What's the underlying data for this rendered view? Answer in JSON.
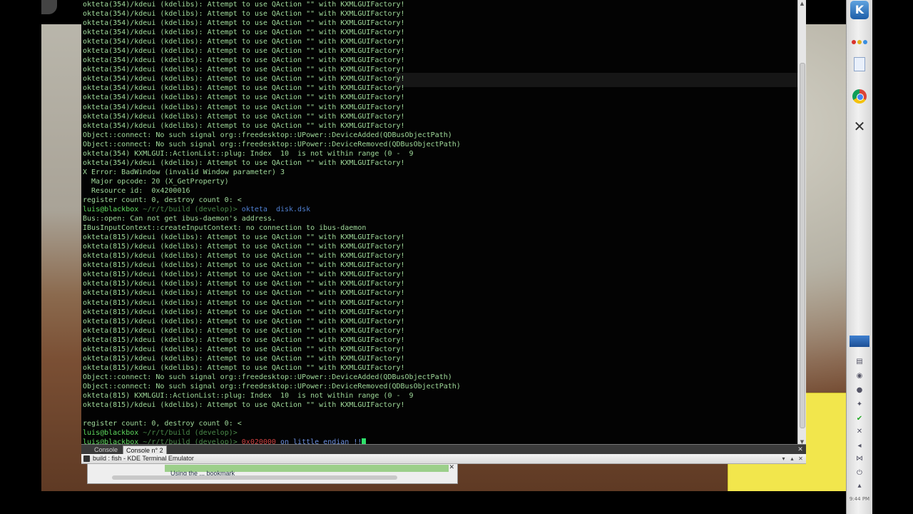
{
  "terminal": {
    "lines": [
      {
        "text": "okteta(354)/kdeui (kdelibs): Attempt to use QAction \"\" with KXMLGUIFactory!"
      },
      {
        "text": "okteta(354)/kdeui (kdelibs): Attempt to use QAction \"\" with KXMLGUIFactory!"
      },
      {
        "text": "okteta(354)/kdeui (kdelibs): Attempt to use QAction \"\" with KXMLGUIFactory!"
      },
      {
        "text": "okteta(354)/kdeui (kdelibs): Attempt to use QAction \"\" with KXMLGUIFactory!"
      },
      {
        "text": "okteta(354)/kdeui (kdelibs): Attempt to use QAction \"\" with KXMLGUIFactory!"
      },
      {
        "text": "okteta(354)/kdeui (kdelibs): Attempt to use QAction \"\" with KXMLGUIFactory!"
      },
      {
        "text": "okteta(354)/kdeui (kdelibs): Attempt to use QAction \"\" with KXMLGUIFactory!"
      },
      {
        "text": "okteta(354)/kdeui (kdelibs): Attempt to use QAction \"\" with KXMLGUIFactory!"
      },
      {
        "text": "okteta(354)/kdeui (kdelibs): Attempt to use QAction \"\" with KXMLGUIFactory!"
      },
      {
        "text": "okteta(354)/kdeui (kdelibs): Attempt to use QAction \"\" with KXMLGUIFactory!"
      },
      {
        "text": "okteta(354)/kdeui (kdelibs): Attempt to use QAction \"\" with KXMLGUIFactory!"
      },
      {
        "text": "okteta(354)/kdeui (kdelibs): Attempt to use QAction \"\" with KXMLGUIFactory!"
      },
      {
        "text": "okteta(354)/kdeui (kdelibs): Attempt to use QAction \"\" with KXMLGUIFactory!"
      },
      {
        "text": "okteta(354)/kdeui (kdelibs): Attempt to use QAction \"\" with KXMLGUIFactory!"
      },
      {
        "text": "Object::connect: No such signal org::freedesktop::UPower::DeviceAdded(QDBusObjectPath)"
      },
      {
        "text": "Object::connect: No such signal org::freedesktop::UPower::DeviceRemoved(QDBusObjectPath)"
      },
      {
        "text": "okteta(354) KXMLGUI::ActionList::plug: Index  10  is not within range (0 -  9"
      },
      {
        "text": "okteta(354)/kdeui (kdelibs): Attempt to use QAction \"\" with KXMLGUIFactory!"
      },
      {
        "text": "X Error: BadWindow (invalid Window parameter) 3"
      },
      {
        "text": "  Major opcode: 20 (X_GetProperty)"
      },
      {
        "text": "  Resource id:  0x4200016"
      },
      {
        "text": "register count: 0, destroy count 0: <"
      },
      {
        "user": "luis@blackbox",
        "path": " ~/r/t/build (develop)> ",
        "cmd": "okteta  disk.dsk"
      },
      {
        "text": "Bus::open: Can not get ibus-daemon's address."
      },
      {
        "text": "IBusInputContext::createInputContext: no connection to ibus-daemon"
      },
      {
        "text": "okteta(815)/kdeui (kdelibs): Attempt to use QAction \"\" with KXMLGUIFactory!"
      },
      {
        "text": "okteta(815)/kdeui (kdelibs): Attempt to use QAction \"\" with KXMLGUIFactory!"
      },
      {
        "text": "okteta(815)/kdeui (kdelibs): Attempt to use QAction \"\" with KXMLGUIFactory!"
      },
      {
        "text": "okteta(815)/kdeui (kdelibs): Attempt to use QAction \"\" with KXMLGUIFactory!"
      },
      {
        "text": "okteta(815)/kdeui (kdelibs): Attempt to use QAction \"\" with KXMLGUIFactory!"
      },
      {
        "text": "okteta(815)/kdeui (kdelibs): Attempt to use QAction \"\" with KXMLGUIFactory!"
      },
      {
        "text": "okteta(815)/kdeui (kdelibs): Attempt to use QAction \"\" with KXMLGUIFactory!"
      },
      {
        "text": "okteta(815)/kdeui (kdelibs): Attempt to use QAction \"\" with KXMLGUIFactory!"
      },
      {
        "text": "okteta(815)/kdeui (kdelibs): Attempt to use QAction \"\" with KXMLGUIFactory!"
      },
      {
        "text": "okteta(815)/kdeui (kdelibs): Attempt to use QAction \"\" with KXMLGUIFactory!"
      },
      {
        "text": "okteta(815)/kdeui (kdelibs): Attempt to use QAction \"\" with KXMLGUIFactory!"
      },
      {
        "text": "okteta(815)/kdeui (kdelibs): Attempt to use QAction \"\" with KXMLGUIFactory!"
      },
      {
        "text": "okteta(815)/kdeui (kdelibs): Attempt to use QAction \"\" with KXMLGUIFactory!"
      },
      {
        "text": "okteta(815)/kdeui (kdelibs): Attempt to use QAction \"\" with KXMLGUIFactory!"
      },
      {
        "text": "okteta(815)/kdeui (kdelibs): Attempt to use QAction \"\" with KXMLGUIFactory!"
      },
      {
        "text": "Object::connect: No such signal org::freedesktop::UPower::DeviceAdded(QDBusObjectPath)"
      },
      {
        "text": "Object::connect: No such signal org::freedesktop::UPower::DeviceRemoved(QDBusObjectPath)"
      },
      {
        "text": "okteta(815) KXMLGUI::ActionList::plug: Index  10  is not within range (0 -  9"
      },
      {
        "text": "okteta(815)/kdeui (kdelibs): Attempt to use QAction \"\" with KXMLGUIFactory!"
      },
      {
        "text": ""
      },
      {
        "text": "register count: 0, destroy count 0: <"
      },
      {
        "user": "luis@blackbox",
        "path": " ~/r/t/build (develop)>",
        "cmd": ""
      },
      {
        "user": "luis@blackbox",
        "path": " ~/r/t/build (develop)> ",
        "err": "0x020000",
        "blue": " on little endian !!",
        "cursor": true
      }
    ]
  },
  "tabs": [
    {
      "label": "Console"
    },
    {
      "label": "Console n° 2"
    }
  ],
  "window_title": "build : fish - KDE Terminal Emulator",
  "bottom_window": {
    "text": "Using the ... bookmark"
  },
  "panel": {
    "icons": [
      "kde-menu-icon",
      "color-dots-icon",
      "document-icon",
      "chrome-icon",
      "tools-icon",
      "desktop-pager-icon"
    ],
    "tray": [
      "notes-icon",
      "network-icon",
      "chrome-tray-icon",
      "twitter-icon",
      "check-icon",
      "close-tray-icon",
      "volume-icon",
      "share-icon",
      "power-icon",
      "arrow-icon"
    ],
    "clock": "9:44 PM"
  },
  "colors": {
    "terminal_bg": "#030303",
    "terminal_text": "#9fd99a",
    "prompt_user": "#5fdc5f",
    "command": "#4f7fd0",
    "error_value": "#d04040",
    "cursor": "#2ee06a"
  }
}
